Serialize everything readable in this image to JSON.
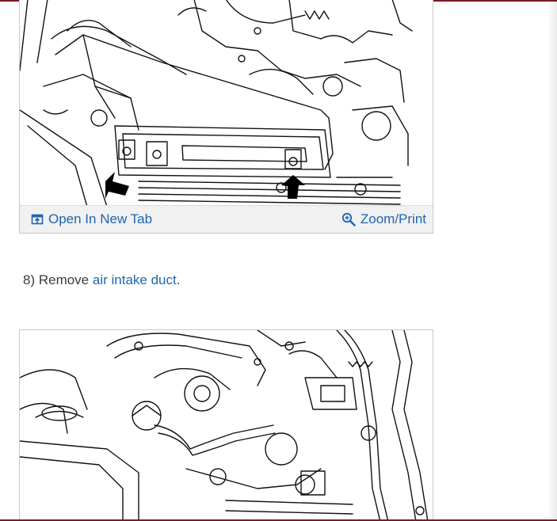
{
  "card_top": {
    "open_tab_label": "Open In New Tab",
    "zoom_print_label": "Zoom/Print",
    "open_tab_icon": "open-in-new-tab-icon",
    "zoom_icon": "zoom-in-icon"
  },
  "step": {
    "prefix": "8) Remove ",
    "link_text": "air intake duct",
    "suffix": "."
  },
  "colors": {
    "link": "#1e66b0",
    "accent_bar": "#7a1a2a",
    "footer_bg": "#f1f1f1"
  }
}
